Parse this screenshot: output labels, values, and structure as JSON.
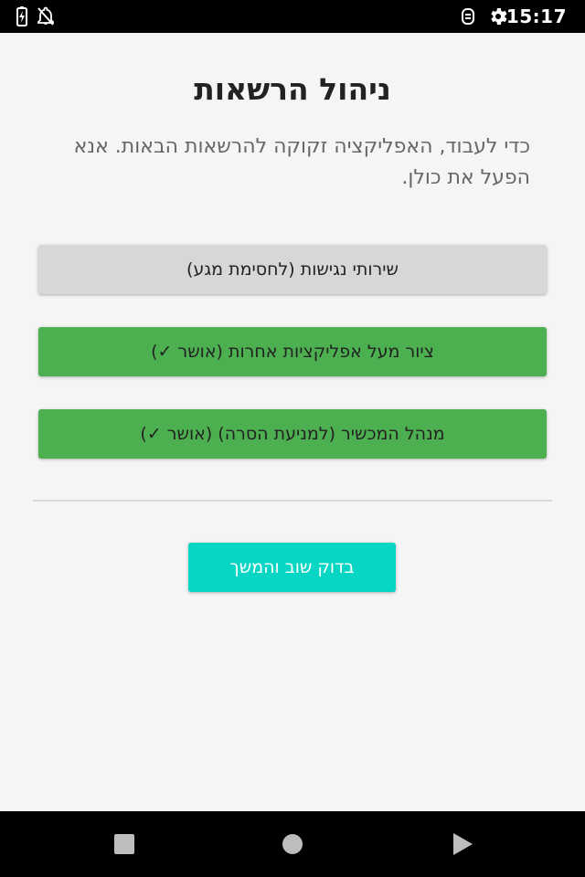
{
  "status_bar": {
    "time": "15:17",
    "icons": [
      "battery-charging-icon",
      "notifications-off-icon",
      "sync-icon",
      "settings-gear-icon"
    ]
  },
  "permissions": {
    "title": "ניהול הרשאות",
    "description": "כדי לעבוד, האפליקציה זקוקה להרשאות הבאות. אנא הפעל את כולן.",
    "items": [
      {
        "label": "שירותי נגישות (לחסימת מגע)",
        "granted": false,
        "color": "#d7d7d7"
      },
      {
        "label": "ציור מעל אפליקציות אחרות (אושר ✓)",
        "granted": true,
        "color": "#4db050"
      },
      {
        "label": "מנהל המכשיר (למניעת הסרה) (אושר ✓)",
        "granted": true,
        "color": "#4db050"
      }
    ],
    "continue_label": "בדוק שוב והמשך",
    "continue_color": "#08d6c4"
  },
  "nav_bar": {
    "icons": [
      "recents-square-icon",
      "home-circle-icon",
      "back-triangle-icon"
    ]
  }
}
